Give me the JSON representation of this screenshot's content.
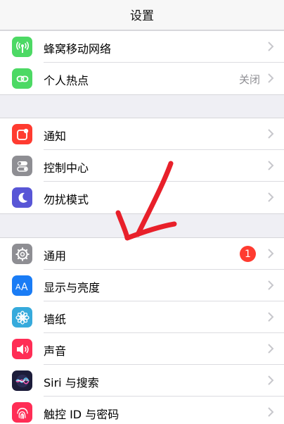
{
  "nav": {
    "title": "设置"
  },
  "groups": [
    {
      "items": [
        {
          "label": "蜂窝移动网络",
          "icon": "cellular-antenna-icon",
          "color": "#4cd964"
        },
        {
          "label": "个人热点",
          "icon": "hotspot-chain-icon",
          "color": "#4cd964",
          "value": "关闭"
        }
      ]
    },
    {
      "items": [
        {
          "label": "通知",
          "icon": "notifications-icon",
          "color": "#ff3b30"
        },
        {
          "label": "控制中心",
          "icon": "control-center-icon",
          "color": "#8e8e93"
        },
        {
          "label": "勿扰模式",
          "icon": "moon-icon",
          "color": "#5856d6"
        }
      ]
    },
    {
      "items": [
        {
          "label": "通用",
          "icon": "gear-icon",
          "color": "#8e8e93",
          "badge": "1"
        },
        {
          "label": "显示与亮度",
          "icon": "text-size-icon",
          "color": "#1a7cf5"
        },
        {
          "label": "墙纸",
          "icon": "wallpaper-flower-icon",
          "color": "#36aadc"
        },
        {
          "label": "声音",
          "icon": "speaker-icon",
          "color": "#ff2d55"
        },
        {
          "label": "Siri 与搜索",
          "icon": "siri-icon",
          "color": "#222244"
        },
        {
          "label": "触控 ID 与密码",
          "icon": "fingerprint-icon",
          "color": "#ff2d55"
        }
      ]
    }
  ],
  "annotation": {
    "icon": "hand-drawn-red-arrow-icon",
    "color": "#e8202a"
  }
}
